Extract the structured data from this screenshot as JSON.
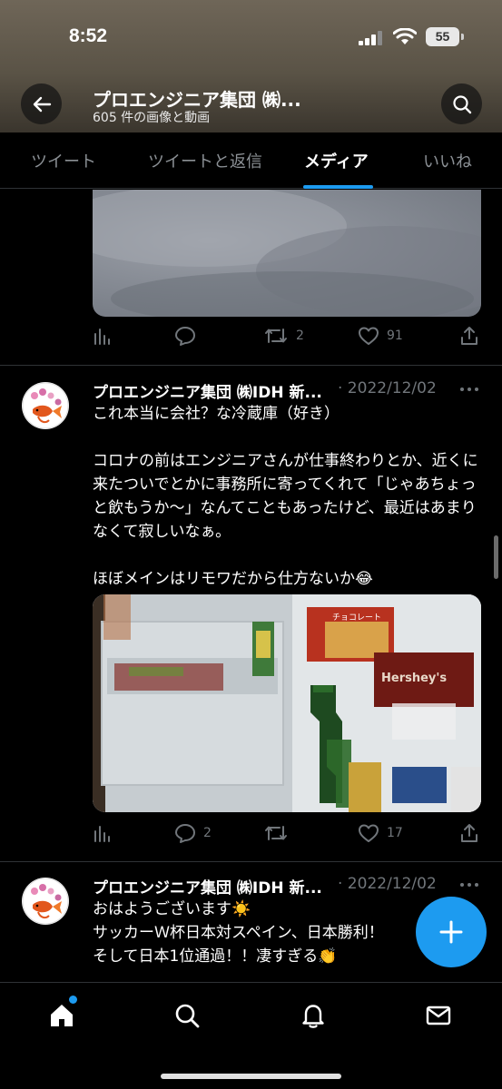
{
  "status": {
    "time": "8:52",
    "battery": "55"
  },
  "header": {
    "title": "プロエンジニア集団 ㈱...",
    "subtitle": "605 件の画像と動画"
  },
  "tabs": [
    {
      "label": "ツイート"
    },
    {
      "label": "ツイートと返信"
    },
    {
      "label": "メディア"
    },
    {
      "label": "いいね"
    }
  ],
  "active_tab": "メディア",
  "post0": {
    "retweets": "2",
    "likes": "91"
  },
  "post1": {
    "author": "プロエンジニア集団 ㈱IDH 新...",
    "date": "· 2022/12/02",
    "text": "これ本当に会社？な冷蔵庫（好き）\n\nコロナの前はエンジニアさんが仕事終わりとか、近くに来たついでとかに事務所に寄ってくれて「じゃあちょっと飲もうか〜」なんてこともあったけど、最近はあまりなくて寂しいなぁ。\n\nほぼメインはリモワだから仕方ないか😂",
    "replies": "2",
    "likes": "17",
    "image_labels": {
      "hershey": "Hershey's",
      "chocolate": "チョコレート"
    }
  },
  "post2": {
    "author": "プロエンジニア集団 ㈱IDH 新...",
    "date": "· 2022/12/02",
    "text": "おはようございます☀️\nサッカーＷ杯日本対スペイン、日本勝利！\nそして日本1位通過！！凄すぎる👏"
  },
  "colors": {
    "accent": "#1d9bf0",
    "background": "#000000",
    "muted": "#71767b"
  },
  "icons": [
    "back-arrow-icon",
    "search-icon",
    "views-icon",
    "reply-icon",
    "retweet-icon",
    "like-icon",
    "share-icon",
    "more-icon",
    "compose-icon",
    "home-icon",
    "explore-icon",
    "notifications-icon",
    "messages-icon"
  ]
}
